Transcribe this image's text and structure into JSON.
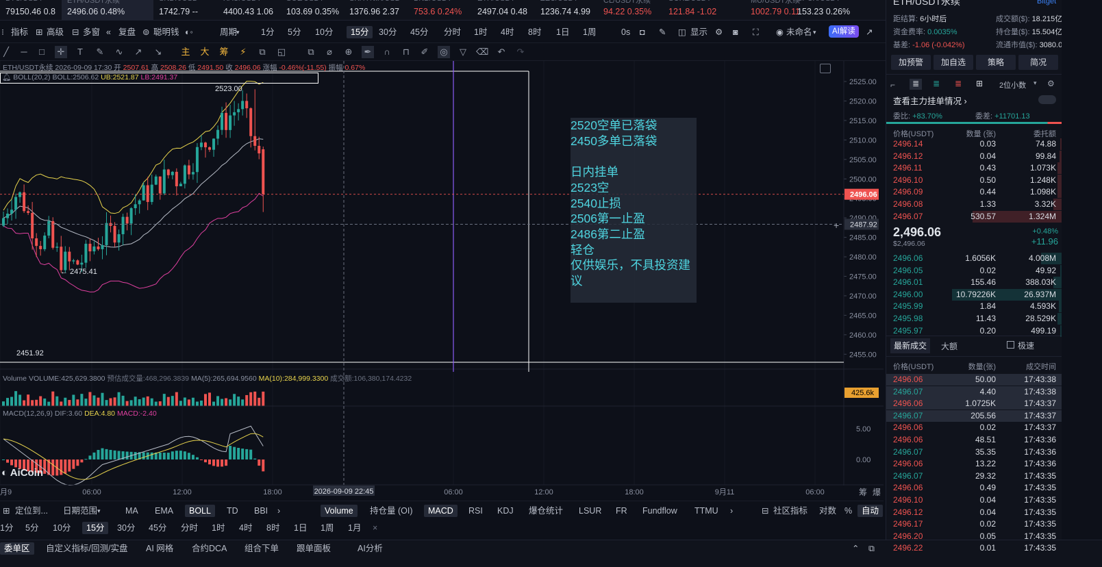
{
  "tickers": [
    {
      "sym": "BTC/USDT",
      "price": "79150.46",
      "chg": "0.8",
      "dir": "wh"
    },
    {
      "sym": "ETH/USDT永续",
      "price": "2496.06",
      "chg": "0.48%",
      "dir": "wh",
      "active": true
    },
    {
      "sym": "SNDK/USD",
      "price": "1742.79",
      "chg": "--",
      "dir": "wh"
    },
    {
      "sym": "XAU/USDT",
      "price": "4400.43",
      "chg": "1.06",
      "dir": "wh"
    },
    {
      "sym": "SOL/USDT",
      "price": "103.69",
      "chg": "0.35%",
      "dir": "wh"
    },
    {
      "sym": "SKHYNIX/USD",
      "price": "1376.96",
      "chg": "2.37",
      "dir": "wh"
    },
    {
      "sym": "BNB/USDT",
      "price": "753.6",
      "chg": "0.24%",
      "dir": "dn"
    },
    {
      "sym": "ETH/USDT",
      "price": "2497.04",
      "chg": "0.48",
      "dir": "wh"
    },
    {
      "sym": "ZEC/USDT",
      "price": "1236.74",
      "chg": "4.99",
      "dir": "wh"
    },
    {
      "sym": "CL/USDT永续",
      "price": "94.22",
      "chg": "0.35%",
      "dir": "dn"
    },
    {
      "sym": "SOXL/USDT",
      "price": "121.84",
      "chg": "-1.02",
      "dir": "dn"
    },
    {
      "sym": "MU/USDT永续",
      "price": "1002.79",
      "chg": "0.11",
      "dir": "dn"
    },
    {
      "sym": "SPCX/USDT",
      "price": "153.23",
      "chg": "0.26%",
      "dir": "wh"
    }
  ],
  "toolbar": {
    "indicator": "指标",
    "advanced": "高级",
    "multi": "多窗",
    "replay": "复盘",
    "smart": "聪明钱",
    "period": "周期",
    "periods": [
      "1分",
      "5分",
      "10分",
      "15分",
      "30分",
      "45分",
      "分时",
      "1时",
      "4时",
      "8时",
      "1日",
      "1周"
    ],
    "selected_period": "15分",
    "zero_s": "0s",
    "display": "显示",
    "unnamed": "未命名",
    "ai": "AI解读"
  },
  "draw_labels": {
    "main": "主",
    "big": "大",
    "chip": "筹"
  },
  "chart": {
    "symbol_line": "ETH/USDT永续 2026-09-09 17:30",
    "open_label": "开",
    "open": "2507.61",
    "high_label": "高",
    "high": "2508.26",
    "low_label": "低",
    "low": "2491.50",
    "close_label": "收",
    "close": "2496.06",
    "chg_label": "涨幅",
    "chg": "-0.46%(-11.55)",
    "amp_label": "振幅",
    "amp": "0.67%",
    "boll_title": "BOLL(20,2)",
    "boll_mid": "BOLL:2506.62",
    "boll_ub": "UB:2521.87",
    "boll_lb": "LB:2491.37",
    "high_marker": "2523.00",
    "low_marker": "2475.41",
    "left_marker": "2451.92",
    "price_ticks": [
      "2525.00",
      "2520.00",
      "2515.00",
      "2510.00",
      "2505.00",
      "2500.00",
      "2495.00",
      "2490.00",
      "2485.00",
      "2480.00",
      "2475.00",
      "2470.00",
      "2465.00",
      "2460.00",
      "2455.00"
    ],
    "last_price_tag": "2496.06",
    "cursor_price_tag": "2487.92",
    "volume_line": "Volume",
    "volume_val": "VOLUME:425,629.3800",
    "vol_pred": "预估成交量:468,296.3839",
    "ma5": "MA(5):265,694.9560",
    "ma10": "MA(10):284,999.3300",
    "turnover": "成交额:106,380,174.4232",
    "vol_tag": "425.6k",
    "macd_line": "MACD(12,26,9)",
    "dif": "DIF:3.60",
    "dea": "DEA:4.80",
    "macd": "MACD:-2.40",
    "macd_ticks": [
      "5.00",
      "0.00"
    ],
    "time_ticks": [
      "月9",
      "06:00",
      "12:00",
      "18:00",
      "06:00",
      "12:00",
      "18:00",
      "9月11",
      "06:00"
    ],
    "cursor_time": "2026-09-09 22:45",
    "brand": "AiCoin",
    "corner_icons": [
      "筹",
      "爆"
    ]
  },
  "annotation": "2520空单已落袋\n2450多单已落袋\n\n日内挂单\n2523空\n2540止损\n2506第一止盈\n2486第二止盈\n轻仓\n仅供娱乐，不具投资建议",
  "bottom1": {
    "locate": "定位到...",
    "range": "日期范围",
    "inds": [
      "MA",
      "EMA",
      "BOLL",
      "TD",
      "BBI"
    ],
    "sel_main": "BOLL",
    "subs": [
      "Volume",
      "持仓量 (OI)",
      "MACD",
      "RSI",
      "KDJ",
      "爆仓统计",
      "LSUR",
      "FR",
      "Fundflow",
      "TTMU"
    ],
    "sel_sub": [
      "Volume",
      "MACD"
    ],
    "community": "社区指标",
    "log": "对数",
    "pct": "%",
    "auto": "自动"
  },
  "bottom2": {
    "periods": [
      "1分",
      "5分",
      "10分",
      "15分",
      "30分",
      "45分",
      "分时",
      "1时",
      "4时",
      "8时",
      "1日",
      "1周",
      "1月"
    ],
    "selected": "15分",
    "close": "×"
  },
  "bottom3": {
    "tabs": [
      "委单区",
      "自定义指标/回测/实盘",
      "AI 网格",
      "合约DCA",
      "组合下单",
      "跟单面板",
      "AI分析"
    ]
  },
  "right": {
    "title": "ETH/USDT永续",
    "exchange": "Bitget",
    "settle_label": "距结算:",
    "settle": "6小时后",
    "vol_label": "成交额($):",
    "vol": "18.215亿",
    "fund_label": "资金费率:",
    "fund": "0.0035%",
    "oi_label": "持仓量($):",
    "oi": "15.504亿",
    "basis_label": "基差:",
    "basis": "-1.06 (-0.042%)",
    "mcap_label": "流通市值($):",
    "mcap": "3080.02亿",
    "buttons": [
      "加预警",
      "加自选",
      "策略",
      "简况"
    ],
    "depth": "2位小数",
    "orderbook_title": "查看主力挂单情况",
    "ratio_label": "委比:",
    "ratio": "+83.70%",
    "diff_label": "委差:",
    "diff": "+11701.13",
    "ob_headers": [
      "价格(USDT)",
      "数量 (张)",
      "委托额"
    ],
    "asks": [
      [
        "2496.14",
        "0.03",
        "74.88"
      ],
      [
        "2496.12",
        "0.04",
        "99.84"
      ],
      [
        "2496.11",
        "0.43",
        "1.073K"
      ],
      [
        "2496.10",
        "0.50",
        "1.248K"
      ],
      [
        "2496.09",
        "0.44",
        "1.098K"
      ],
      [
        "2496.08",
        "1.33",
        "3.32K"
      ],
      [
        "2496.07",
        "530.57",
        "1.324M"
      ]
    ],
    "mid_price": "2,496.06",
    "mid_usd": "$2,496.06",
    "mid_pct": "+0.48%",
    "mid_chg": "+11.96",
    "bids": [
      [
        "2496.06",
        "1.6056K",
        "4.008M"
      ],
      [
        "2496.05",
        "0.02",
        "49.92"
      ],
      [
        "2496.01",
        "155.46",
        "388.03K"
      ],
      [
        "2496.00",
        "10.79226K",
        "26.937M"
      ],
      [
        "2495.99",
        "1.84",
        "4.593K"
      ],
      [
        "2495.98",
        "11.43",
        "28.529K"
      ],
      [
        "2495.97",
        "0.20",
        "499.19"
      ]
    ],
    "trades_tab": "最新成交",
    "big_tab": "大额",
    "fast": "极速",
    "trade_headers": [
      "价格(USDT)",
      "数量(张)",
      "成交时间"
    ],
    "trades": [
      [
        "2496.06",
        "50.00",
        "17:43:38",
        "dn"
      ],
      [
        "2496.07",
        "4.40",
        "17:43:38",
        "up"
      ],
      [
        "2496.06",
        "1.0725K",
        "17:43:37",
        "dn"
      ],
      [
        "2496.07",
        "205.56",
        "17:43:37",
        "up"
      ],
      [
        "2496.06",
        "0.02",
        "17:43:37",
        "dn"
      ],
      [
        "2496.06",
        "48.51",
        "17:43:36",
        "dn"
      ],
      [
        "2496.07",
        "35.35",
        "17:43:36",
        "up"
      ],
      [
        "2496.06",
        "13.22",
        "17:43:36",
        "dn"
      ],
      [
        "2496.07",
        "29.32",
        "17:43:35",
        "up"
      ],
      [
        "2496.06",
        "0.49",
        "17:43:35",
        "dn"
      ],
      [
        "2496.10",
        "0.04",
        "17:43:35",
        "dn"
      ],
      [
        "2496.12",
        "0.04",
        "17:43:35",
        "dn"
      ],
      [
        "2496.17",
        "0.02",
        "17:43:35",
        "dn"
      ],
      [
        "2496.20",
        "0.05",
        "17:43:35",
        "dn"
      ],
      [
        "2496.22",
        "0.01",
        "17:43:35",
        "dn"
      ]
    ]
  },
  "colors": {
    "up": "#26a69a",
    "down": "#ef5350",
    "bg": "#0d1019",
    "boll_ub": "#e8d44d",
    "boll_lb": "#e040a0",
    "annot": "#4fd5e0"
  }
}
